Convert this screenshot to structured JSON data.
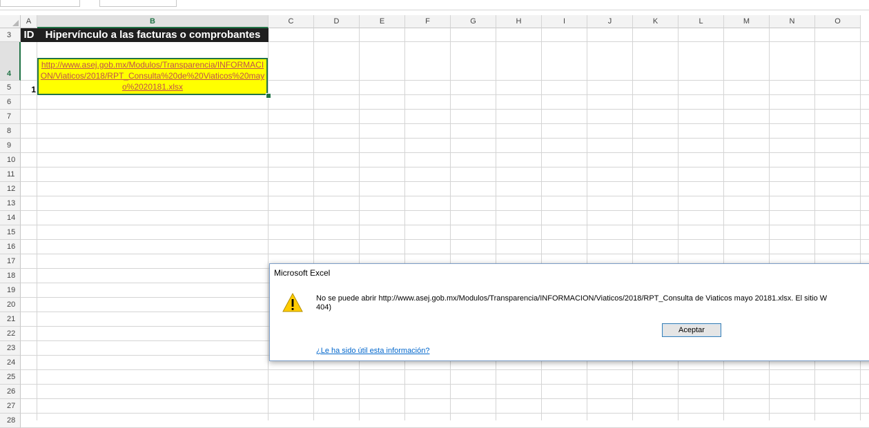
{
  "columns": [
    "A",
    "B",
    "C",
    "D",
    "E",
    "F",
    "G",
    "H",
    "I",
    "J",
    "K",
    "L",
    "M",
    "N",
    "O"
  ],
  "active_column": "B",
  "rows": [
    "3",
    "4",
    "5",
    "6",
    "7",
    "8",
    "9",
    "10",
    "11",
    "12",
    "13",
    "14",
    "15",
    "16",
    "17",
    "18",
    "19",
    "20",
    "21",
    "22",
    "23",
    "24",
    "25",
    "26",
    "27",
    "28"
  ],
  "active_row": "4",
  "header_row": {
    "id_label": "ID",
    "link_header": "Hipervínculo a las facturas o comprobantes"
  },
  "data_row": {
    "id": "1",
    "link": "http://www.asej.gob.mx/Modulos/Transparencia/INFORMACION/Viaticos/2018/RPT_Consulta%20de%20Viaticos%20mayo%2020181.xlsx"
  },
  "dialog": {
    "title": "Microsoft Excel",
    "message_line1": "No se puede abrir http://www.asej.gob.mx/Modulos/Transparencia/INFORMACION/Viaticos/2018/RPT_Consulta de Viaticos mayo 20181.xlsx. El sitio W",
    "message_line2": "404)",
    "ok_button": "Aceptar",
    "help_link": "¿Le ha sido útil esta información?",
    "icon": "warning-icon"
  },
  "colors": {
    "accent": "#217346",
    "highlight": "#ffff00",
    "header_bg": "#1f1f1f",
    "link": "#c0504d"
  }
}
